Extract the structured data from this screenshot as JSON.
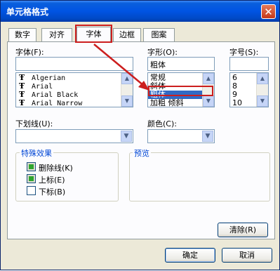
{
  "window": {
    "title": "单元格格式",
    "close_glyph": "✕"
  },
  "tabs": [
    {
      "label": "数字"
    },
    {
      "label": "对齐"
    },
    {
      "label": "字体",
      "active": true
    },
    {
      "label": "边框"
    },
    {
      "label": "图案"
    }
  ],
  "font": {
    "label": "字体(F):",
    "value": "",
    "items": [
      "Algerian",
      "Arial",
      "Arial Black",
      "Arial Narrow"
    ],
    "icon_glyph": "Ŧ"
  },
  "style": {
    "label": "字形(O):",
    "value": "粗体",
    "items": [
      "常规",
      "斜体",
      "粗体",
      "加粗 倾斜"
    ],
    "selected_index": 2
  },
  "size": {
    "label": "字号(S):",
    "value": "",
    "items": [
      "6",
      "8",
      "9",
      "10"
    ]
  },
  "underline": {
    "label": "下划线(U):",
    "value": ""
  },
  "color": {
    "label": "颜色(C):",
    "value": ""
  },
  "effects": {
    "title": "特殊效果",
    "items": [
      {
        "label": "删除线(K)",
        "state": "mixed"
      },
      {
        "label": "上标(E)",
        "state": "mixed"
      },
      {
        "label": "下标(B)",
        "state": "unchecked"
      }
    ]
  },
  "preview": {
    "title": "预览"
  },
  "buttons": {
    "clear": "清除(R)",
    "ok": "确定",
    "cancel": "取消"
  },
  "colors": {
    "annotation": "#cc1e1e",
    "selection": "#316ac5",
    "group_title": "#0046d5"
  }
}
